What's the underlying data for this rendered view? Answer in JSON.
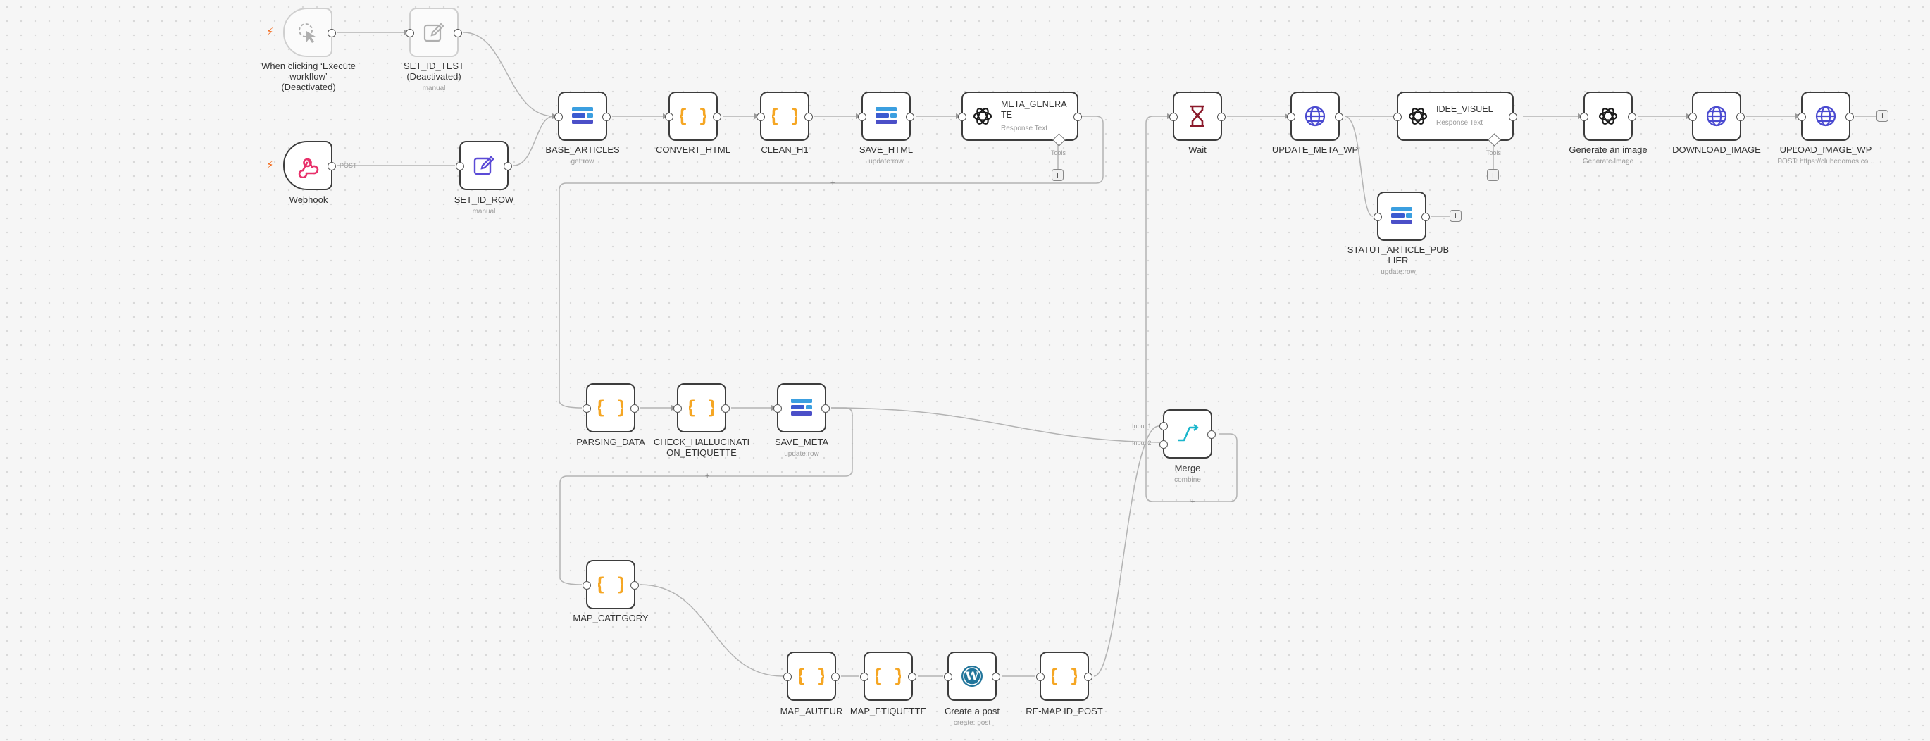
{
  "nodes": {
    "trigger_manual": {
      "title": "When clicking ‘Execute workflow’",
      "status": "(Deactivated)"
    },
    "set_id_test": {
      "title": "SET_ID_TEST",
      "status": "(Deactivated)",
      "sub": "manual"
    },
    "webhook": {
      "title": "Webhook",
      "port_label": "POST"
    },
    "set_id_row": {
      "title": "SET_ID_ROW",
      "sub": "manual"
    },
    "base_articles": {
      "title": "BASE_ARTICLES",
      "sub": "get:row"
    },
    "convert_html": {
      "title": "CONVERT_HTML"
    },
    "clean_h1": {
      "title": "CLEAN_H1"
    },
    "save_html": {
      "title": "SAVE_HTML",
      "sub": "update:row"
    },
    "meta_generate": {
      "title": "META_GENERATE",
      "sub": "Response Text",
      "tools_label": "Tools"
    },
    "wait": {
      "title": "Wait"
    },
    "update_meta_wp": {
      "title": "UPDATE_META_WP"
    },
    "idee_visuel": {
      "title": "IDEE_VISUEL",
      "sub": "Response Text",
      "tools_label": "Tools"
    },
    "generate_image": {
      "title": "Generate an image",
      "sub": "Generate Image"
    },
    "download_image": {
      "title": "DOWNLOAD_IMAGE"
    },
    "upload_image_wp": {
      "title": "UPLOAD_IMAGE_WP",
      "sub": "POST: https://clubedomos.co..."
    },
    "statut_article": {
      "title": "STATUT_ARTICLE_PUBLIER",
      "sub": "update:row"
    },
    "parsing_data": {
      "title": "PARSING_DATA"
    },
    "check_halluc": {
      "title": "CHECK_HALLUCINATION_ETIQUETTE"
    },
    "save_meta": {
      "title": "SAVE_META",
      "sub": "update:row"
    },
    "merge": {
      "title": "Merge",
      "sub": "combine",
      "input1": "Input 1",
      "input2": "Input 2"
    },
    "map_category": {
      "title": "MAP_CATEGORY"
    },
    "map_auteur": {
      "title": "MAP_AUTEUR"
    },
    "map_etiquette": {
      "title": "MAP_ETIQUETTE"
    },
    "create_post": {
      "title": "Create a post",
      "sub": "create: post"
    },
    "remap_id_post": {
      "title": "RE-MAP ID_POST"
    }
  },
  "colors": {
    "trigger_bolt": "#f26a1b",
    "code_braces": "#f5a623",
    "datatable_blue": "#3b9fe0",
    "webhook_pink": "#e8306a",
    "edit_purple": "#5b4bd6",
    "http_globe": "#4a4ad0",
    "wait_maroon": "#8b1a2b",
    "merge_teal": "#1bb6cc",
    "wordpress_blue": "#21759b"
  }
}
